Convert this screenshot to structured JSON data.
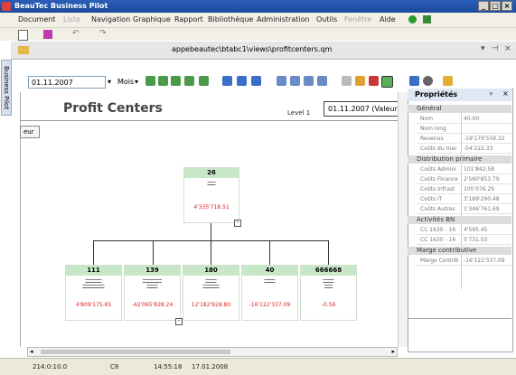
{
  "window": {
    "title": "BeauTec Business Pilot",
    "buttons": [
      "_",
      "□",
      "×"
    ]
  },
  "menu": [
    {
      "label": "Document",
      "disabled": false
    },
    {
      "label": "Liste",
      "disabled": true
    },
    {
      "label": "Navigation",
      "disabled": false
    },
    {
      "label": "Graphique",
      "disabled": false
    },
    {
      "label": "Rapport",
      "disabled": false
    },
    {
      "label": "Bibliothèque",
      "disabled": false
    },
    {
      "label": "Administration",
      "disabled": false
    },
    {
      "label": "Outils",
      "disabled": false
    },
    {
      "label": "Fenêtre",
      "disabled": true
    },
    {
      "label": "Aide",
      "disabled": false
    }
  ],
  "address": {
    "path": "appebeautec\\btabc1\\views\\profitcenters.qm"
  },
  "sidebar": {
    "tab_label": "Business Pilot"
  },
  "toolbar": {
    "date": "01.11.2007",
    "period": "Mois"
  },
  "report": {
    "title": "Profit Centers",
    "level_label": "Level 1",
    "date_field": "01.11.2007 (Valeur)",
    "small_button": "eur"
  },
  "tree": {
    "root": {
      "id": "26",
      "value": "4'335'718.51"
    },
    "children": [
      {
        "id": "111",
        "value": "4'809'175.65"
      },
      {
        "id": "139",
        "value": "-42'065'828.24"
      },
      {
        "id": "180",
        "value": "12'182'928.80"
      },
      {
        "id": "40",
        "value": "-16'122'337.09"
      },
      {
        "id": "666668",
        "value": "-0.56"
      }
    ]
  },
  "properties": {
    "title": "Propriétés",
    "sections": [
      {
        "name": "Général",
        "rows": [
          {
            "k": "Nom",
            "v": "40.00"
          },
          {
            "k": "Nom long",
            "v": ""
          },
          {
            "k": "Revenus",
            "v": "-19'176'559.32"
          },
          {
            "k": "Coûts du mar",
            "v": "-54'222.33"
          }
        ]
      },
      {
        "name": "Distribution primaire",
        "rows": [
          {
            "k": "Coûts Admini",
            "v": "101'842.58"
          },
          {
            "k": "Coûts Finance",
            "v": "2'560'853.79"
          },
          {
            "k": "Coûts Infrast",
            "v": "105'076.29"
          },
          {
            "k": "Coûts IT",
            "v": "3'189'290.48"
          },
          {
            "k": "Coûts Autres",
            "v": "1'346'761.69"
          }
        ]
      },
      {
        "name": "Activités BN",
        "rows": [
          {
            "k": "CC 1630 - 16",
            "v": "4'595.45"
          },
          {
            "k": "CC 1630 - 16",
            "v": "5'731.03"
          }
        ]
      },
      {
        "name": "Marge contributive",
        "rows": [
          {
            "k": "Marge Contrib",
            "v": "-16'122'337.09"
          }
        ]
      }
    ]
  },
  "status": {
    "pos": "214:0:10.0",
    "mode": "C8",
    "time": "14:55:18",
    "date": "17.01.2008"
  }
}
